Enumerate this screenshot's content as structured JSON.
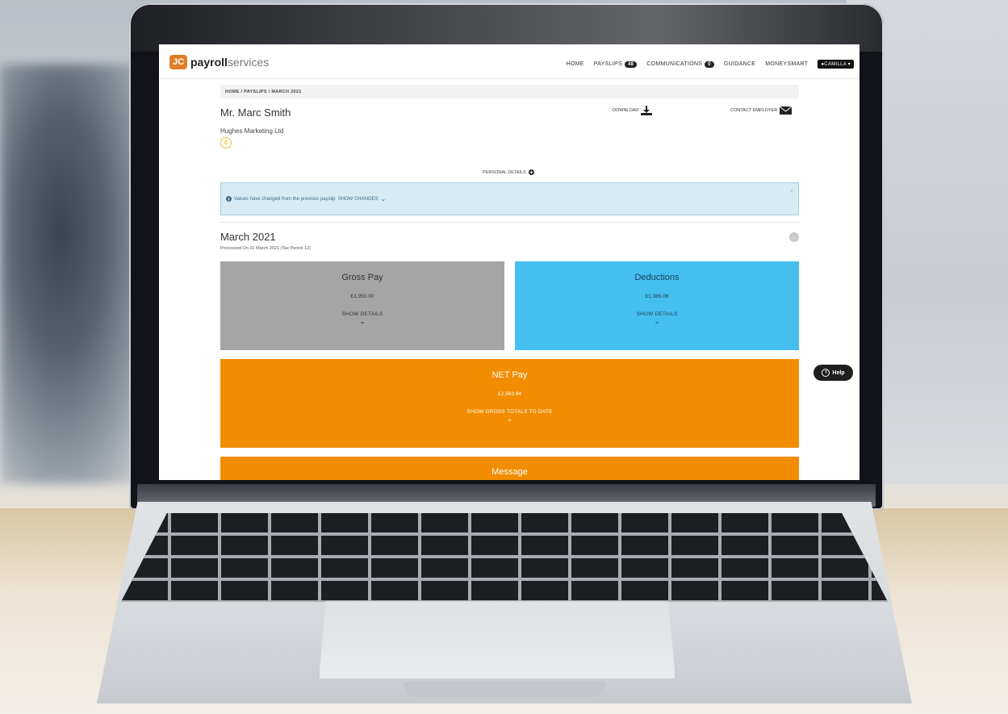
{
  "nav": {
    "brand_initials": "JC",
    "brand_bold": "payroll",
    "brand_light": "services",
    "links": {
      "home": "HOME",
      "payslips": "PAYSLIPS",
      "payslips_count": "48",
      "communications": "COMMUNICATIONS",
      "communications_count": "0",
      "guidance": "GUIDANCE",
      "moneysmart": "MONEYSMART"
    },
    "user": "CAMILLA"
  },
  "breadcrumb": "HOME  /  PAYSLIPS  /  MARCH 2021",
  "employee": {
    "name": "Mr. Marc Smith",
    "company": "Hughes Marketing Ltd"
  },
  "actions": {
    "download": "DOWNLOAD",
    "contact": "CONTACT EMPLOYER",
    "personal_details": "PERSONAL DETAILS"
  },
  "alert": {
    "text": "Values have changed from the previous payslip",
    "link": "SHOW CHANGES",
    "close": "×"
  },
  "period": {
    "title": "March 2021",
    "subtitle": "Processed On 31 March 2021 (Tax Period 12)"
  },
  "cards": {
    "gross": {
      "title": "Gross Pay",
      "amount": "£3,950.00",
      "link": "SHOW DETAILS"
    },
    "deductions": {
      "title": "Deductions",
      "amount": "£1,386.06",
      "link": "SHOW DETAILS"
    },
    "net": {
      "title": "NET Pay",
      "amount": "£2,563.94",
      "link": "SHOW GROSS TOTALS TO DATE"
    },
    "message": {
      "title": "Message"
    }
  },
  "help": {
    "label": "Help"
  },
  "colors": {
    "brand": "#e07e27",
    "gross": "#a5a5a5",
    "deductions": "#45bff0",
    "net": "#f28c00",
    "alert_bg": "#d7ebf5"
  }
}
